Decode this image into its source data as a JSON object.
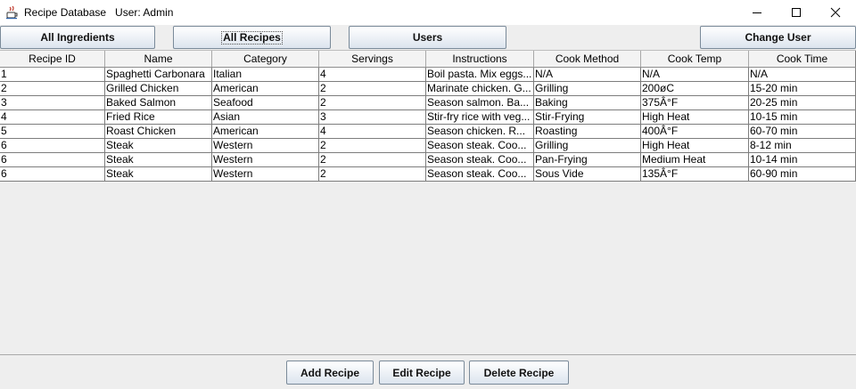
{
  "window": {
    "title": "Recipe Database   User: Admin",
    "app_icon": "java-cup-icon"
  },
  "toolbar": {
    "all_ingredients": "All Ingredients",
    "all_recipes": "All Recipes",
    "users": "Users",
    "change_user": "Change User"
  },
  "table": {
    "columns": [
      "Recipe ID",
      "Name",
      "Category",
      "Servings",
      "Instructions",
      "Cook Method",
      "Cook Temp",
      "Cook Time"
    ],
    "rows": [
      [
        "1",
        "Spaghetti Carbonara",
        "Italian",
        "4",
        "Boil pasta. Mix eggs...",
        "N/A",
        "N/A",
        "N/A"
      ],
      [
        "2",
        "Grilled Chicken",
        "American",
        "2",
        "Marinate chicken. G...",
        "Grilling",
        "200øC",
        "15-20 min"
      ],
      [
        "3",
        "Baked Salmon",
        "Seafood",
        "2",
        "Season salmon. Ba...",
        "Baking",
        "375Â°F",
        "20-25 min"
      ],
      [
        "4",
        "Fried Rice",
        "Asian",
        "3",
        "Stir-fry rice with veg...",
        "Stir-Frying",
        "High Heat",
        "10-15 min"
      ],
      [
        "5",
        "Roast Chicken",
        "American",
        "4",
        "Season chicken. R...",
        "Roasting",
        "400Â°F",
        "60-70 min"
      ],
      [
        "6",
        "Steak",
        "Western",
        "2",
        "Season steak. Coo...",
        "Grilling",
        "High Heat",
        "8-12 min"
      ],
      [
        "6",
        "Steak",
        "Western",
        "2",
        "Season steak. Coo...",
        "Pan-Frying",
        "Medium Heat",
        "10-14 min"
      ],
      [
        "6",
        "Steak",
        "Western",
        "2",
        "Season steak. Coo...",
        "Sous Vide",
        "135Â°F",
        "60-90 min"
      ]
    ]
  },
  "actions": {
    "add": "Add Recipe",
    "edit": "Edit Recipe",
    "delete": "Delete Recipe"
  }
}
